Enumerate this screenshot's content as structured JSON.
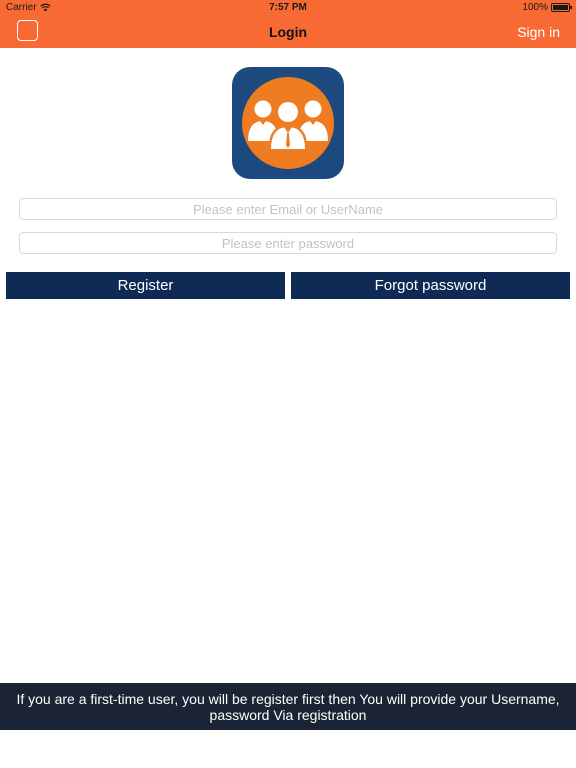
{
  "status_bar": {
    "carrier": "Carrier",
    "time": "7:57 PM",
    "battery": "100%"
  },
  "nav_bar": {
    "title": "Login",
    "sign_in_label": "Sign in",
    "color": "#f86a33"
  },
  "logo": {
    "icon": "group-of-people-icon",
    "background_color": "#1c4a7e",
    "accent_color": "#f07c22"
  },
  "form": {
    "email_placeholder": "Please enter Email or UserName",
    "email_value": "",
    "password_placeholder": "Please enter password",
    "password_value": ""
  },
  "buttons": {
    "register_label": "Register",
    "forgot_password_label": "Forgot password",
    "color": "#0f2a54"
  },
  "footer": {
    "message": "If you are a first-time user, you will be register first then You will provide your Username, password Via registration"
  }
}
